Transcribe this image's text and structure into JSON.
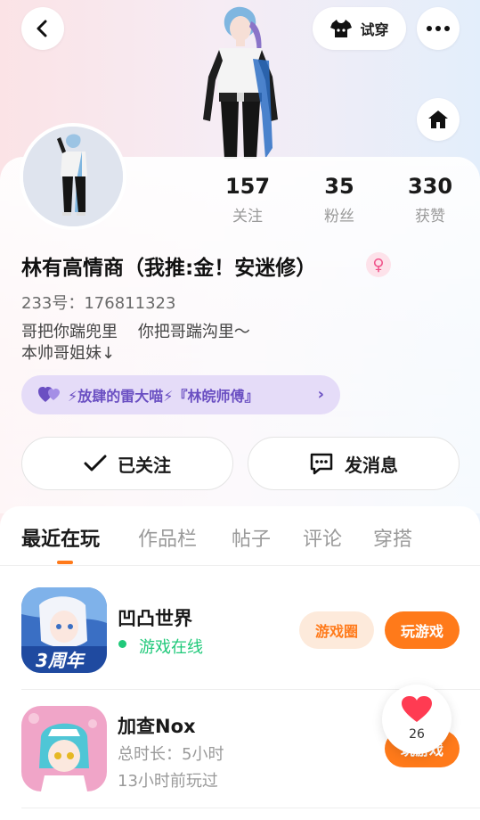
{
  "header": {
    "tryon_label": "试穿",
    "back_icon": "chevron-left-icon",
    "more_icon": "more-dots-icon",
    "home_icon": "home-icon",
    "tryon_icon": "tshirt-icon"
  },
  "profile": {
    "stats": [
      {
        "value": "157",
        "label": "关注"
      },
      {
        "value": "35",
        "label": "粉丝"
      },
      {
        "value": "330",
        "label": "获赞"
      }
    ],
    "nickname": "林有高情商（我推:金！安迷修）",
    "gender_symbol": "♀",
    "uid": "233号：176811323",
    "bio": "哥把你踹兜里    你把哥踹沟里～\n本帅哥姐妹↓",
    "guild_text": "⚡放肆的雷大喵⚡『林皖师傅』",
    "guild_chevron": "›",
    "follow_label": "已关注",
    "message_label": "发消息"
  },
  "tabs": [
    "最近在玩",
    "作品栏",
    "帖子",
    "评论",
    "穿搭"
  ],
  "games": [
    {
      "title": "凹凸世界",
      "status": "游戏在线",
      "circle_label": "游戏圈",
      "play_label": "玩游戏",
      "icon_badge": "3周年"
    },
    {
      "title": "加查Nox",
      "duration": "总时长：5小时",
      "last_played": "13小时前玩过",
      "play_label": "玩游戏"
    }
  ],
  "like_float": {
    "count": "26"
  },
  "colors": {
    "accent": "#ff7a1a",
    "online": "#20c97a",
    "guild_bg": "#e5dcf8",
    "guild_text": "#6a4fc2",
    "gender_pink": "#f0528a"
  }
}
